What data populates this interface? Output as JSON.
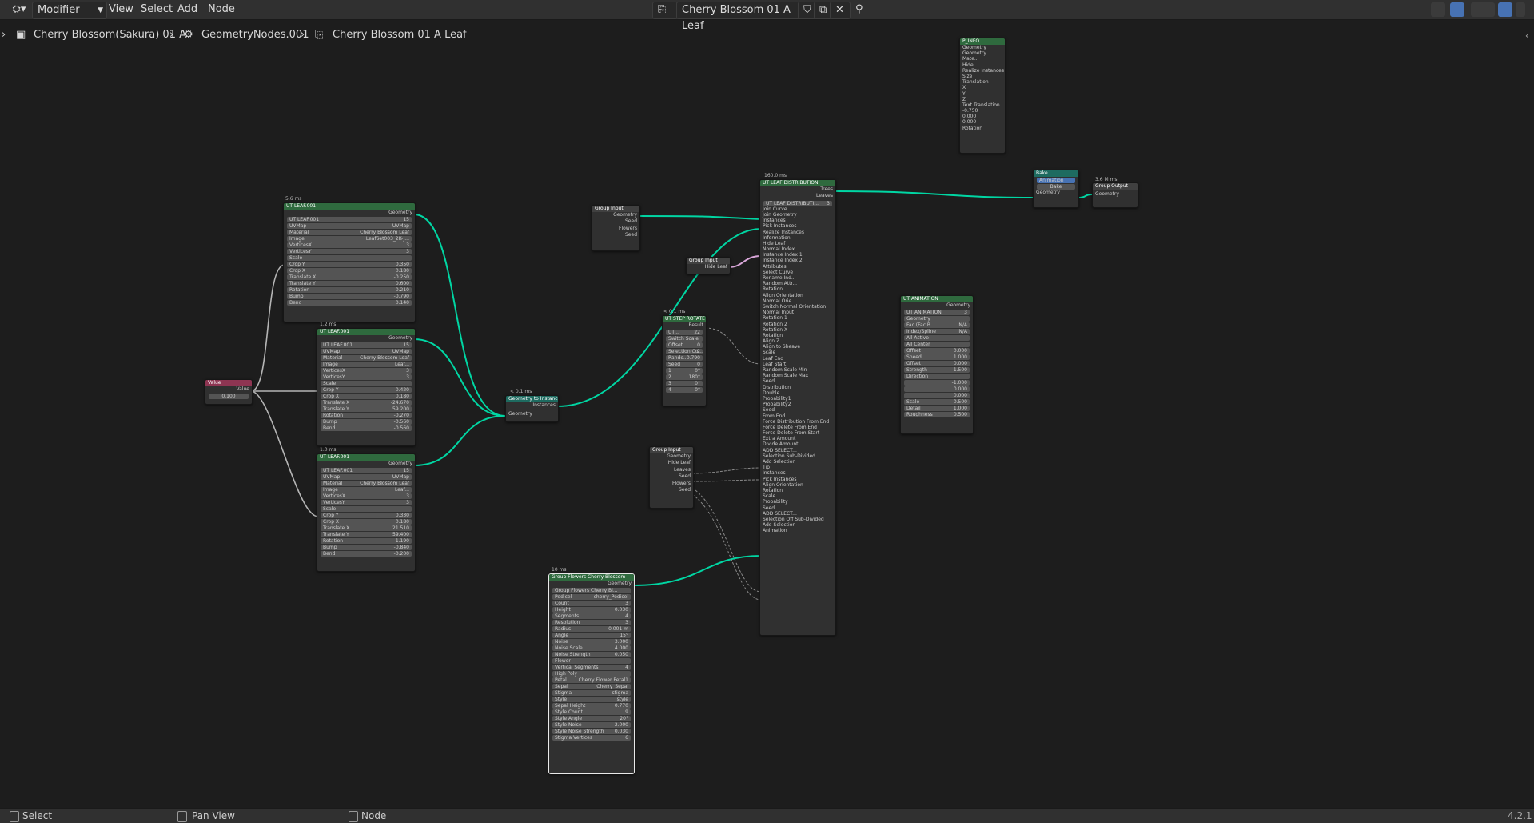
{
  "topbar": {
    "editor_type": "Modifier",
    "menus": [
      "View",
      "Select",
      "Add",
      "Node"
    ],
    "tree_name": "Cherry Blossom 01 A Leaf"
  },
  "breadcrumb": [
    "Cherry Blossom(Sakura) 01 A",
    "GeometryNodes.001",
    "Cherry Blossom 01 A Leaf"
  ],
  "status": {
    "select": "Select",
    "pan": "Pan View",
    "node": "Node",
    "version": "4.2.1"
  },
  "nodes": {
    "leaf1": {
      "timing": "5.6 ms",
      "title": "UT LEAF.001",
      "group": "UT LEAF.001",
      "users": "15",
      "rows": [
        {
          "l": "UVMap",
          "v": "UVMap"
        },
        {
          "l": "Material",
          "v": "Cherry Blossom Leaf"
        },
        {
          "l": "Image",
          "v": "LeafSet003_2K-J..."
        },
        {
          "l": "VerticesX",
          "v": "3"
        },
        {
          "l": "VerticesY",
          "v": "3"
        },
        {
          "l": "Scale",
          "v": ""
        },
        {
          "l": "Crop Y",
          "v": "0.350"
        },
        {
          "l": "Crop X",
          "v": "0.180"
        },
        {
          "l": "Translate X",
          "v": "-0.250"
        },
        {
          "l": "Translate Y",
          "v": "0.600"
        },
        {
          "l": "Rotation",
          "v": "0.210"
        },
        {
          "l": "Bump",
          "v": "-0.790"
        },
        {
          "l": "Bend",
          "v": "0.140"
        }
      ]
    },
    "leaf2": {
      "timing": "1.2 ms",
      "title": "UT LEAF.001",
      "group": "UT LEAF.001",
      "users": "15",
      "rows": [
        {
          "l": "UVMap",
          "v": "UVMap"
        },
        {
          "l": "Material",
          "v": "Cherry Blossom Leaf"
        },
        {
          "l": "Image",
          "v": "Leaf..."
        },
        {
          "l": "VerticesX",
          "v": "3"
        },
        {
          "l": "VerticesY",
          "v": "3"
        },
        {
          "l": "Scale",
          "v": ""
        },
        {
          "l": "Crop Y",
          "v": "0.420"
        },
        {
          "l": "Crop X",
          "v": "0.180"
        },
        {
          "l": "Translate X",
          "v": "-24.670"
        },
        {
          "l": "Translate Y",
          "v": "59.200"
        },
        {
          "l": "Rotation",
          "v": "-0.270"
        },
        {
          "l": "Bump",
          "v": "-0.560"
        },
        {
          "l": "Bend",
          "v": "-0.560"
        }
      ]
    },
    "leaf3": {
      "timing": "1.0 ms",
      "title": "UT LEAF.001",
      "group": "UT LEAF.001",
      "users": "15",
      "rows": [
        {
          "l": "UVMap",
          "v": "UVMap"
        },
        {
          "l": "Material",
          "v": "Cherry Blossom Leaf"
        },
        {
          "l": "Image",
          "v": "Leaf..."
        },
        {
          "l": "VerticesX",
          "v": "3"
        },
        {
          "l": "VerticesY",
          "v": "3"
        },
        {
          "l": "Scale",
          "v": ""
        },
        {
          "l": "Crop Y",
          "v": "0.330"
        },
        {
          "l": "Crop X",
          "v": "0.180"
        },
        {
          "l": "Translate X",
          "v": "21.510"
        },
        {
          "l": "Translate Y",
          "v": "59.400"
        },
        {
          "l": "Rotation",
          "v": "-1.190"
        },
        {
          "l": "Bump",
          "v": "-0.840"
        },
        {
          "l": "Bend",
          "v": "-0.200"
        }
      ]
    },
    "value": {
      "title": "Value",
      "label": "Value",
      "value": "0.100"
    },
    "g2i": {
      "timing": "< 0.1 ms",
      "title": "Geometry to Instance",
      "out": "Instances",
      "in": "Geometry"
    },
    "gi1": {
      "title": "Group Input",
      "rows": [
        "Geometry",
        "Seed",
        "Flowers",
        "Seed"
      ]
    },
    "hide": {
      "title": "Group Input",
      "row": "Hide Leaf"
    },
    "step": {
      "timing": "< 0.1 ms",
      "title": "UT STEP ROTATE",
      "group": "UT...",
      "users": "22",
      "rows": [
        {
          "l": "Switch Scale",
          "v": ""
        },
        {
          "l": "Offset",
          "v": "0"
        },
        {
          "l": "Selection Co...",
          "v": "2"
        },
        {
          "l": "Rando...",
          "v": "0.790"
        },
        {
          "l": "Seed",
          "v": "0"
        },
        {
          "l": "1",
          "v": "0°"
        },
        {
          "l": "2",
          "v": "180°"
        },
        {
          "l": "3",
          "v": "0°"
        },
        {
          "l": "4",
          "v": "0°"
        }
      ]
    },
    "dist": {
      "timing": "160.0 ms",
      "title": "UT LEAF DISTRIBUTION",
      "group": "UT LEAF DISTRIBUTI...",
      "users": "3",
      "rows": [
        "Join Curve",
        "Join Geometry",
        "Instances",
        "Pick Instances",
        "Realize Instances",
        "Information",
        "Hide Leaf",
        "Normal Index",
        "Instance Index 1",
        "Instance Index 2",
        "Attributes",
        "Select Curve",
        "Rename Ind...",
        "Random Attr...",
        "Rotation",
        "Align Orientation",
        "Normal Orie...",
        "Switch Normal Orientation",
        "Normal Input",
        "Rotation 1",
        "Rotation 2",
        "Rotation X",
        "Rotation",
        "Align Z",
        "Align to Sheave",
        "Scale",
        "Leaf End",
        "Leaf Start",
        "Random Scale Min",
        "Random Scale Max",
        "Seed",
        "Distribution",
        "Double",
        "Probability1",
        "Probability2",
        "Seed",
        "From End",
        "Force Distribution From End",
        "Force Delete From End",
        "Force Delete From Start",
        "Extra Amount",
        "Divide Amount",
        "ADD SELECT...",
        "Selection Sub-Divided",
        "Add Selection",
        "Tip",
        "Instances",
        "Pick Instances",
        "Align Orientation",
        "Rotation",
        "Scale",
        "Probability",
        "Seed",
        "ADD SELECT...",
        "Selection Off Sub-Divided",
        "Add Selection",
        "Animation"
      ]
    },
    "gi2": {
      "title": "Group Input",
      "rows": [
        "Geometry",
        "Hide Leaf",
        "Leaves",
        "Seed",
        "Flowers",
        "Seed"
      ]
    },
    "flowers": {
      "timing": "10 ms",
      "title": "Group Flowers Cherry Blossom",
      "group": "Group Flowers Cherry Bl...",
      "rows": [
        {
          "l": "Pedicel",
          "v": "cherry_Pedicel"
        },
        {
          "l": "Count",
          "v": "3"
        },
        {
          "l": "Height",
          "v": "0.030"
        },
        {
          "l": "Segments",
          "v": "4"
        },
        {
          "l": "Resolution",
          "v": "3"
        },
        {
          "l": "Radius",
          "v": "0.001 m"
        },
        {
          "l": "Angle",
          "v": "15°"
        },
        {
          "l": "Noise",
          "v": "3.000"
        },
        {
          "l": "Noise Scale",
          "v": "4.000"
        },
        {
          "l": "Noise Strength",
          "v": "0.050"
        },
        {
          "l": "Flower",
          "v": ""
        },
        {
          "l": "Vertical Segments",
          "v": "4"
        },
        {
          "l": "High Poly",
          "v": ""
        },
        {
          "l": "Petal",
          "v": "Cherry Flower Petal1"
        },
        {
          "l": "Sepal",
          "v": "Cherry_Sepal"
        },
        {
          "l": "Stigma",
          "v": "stigma"
        },
        {
          "l": "Style",
          "v": "style"
        },
        {
          "l": "Sepal Height",
          "v": "0.770"
        },
        {
          "l": "Style Count",
          "v": "9"
        },
        {
          "l": "Style Angle",
          "v": "20°"
        },
        {
          "l": "Style Noise",
          "v": "2.000"
        },
        {
          "l": "Style Noise Strength",
          "v": "0.030"
        },
        {
          "l": "Stigma Vertices",
          "v": "6"
        }
      ]
    },
    "pinfo": {
      "title": "P_INFO",
      "rows": [
        "Geometry",
        "Geometry",
        "Mate...",
        "Hide",
        "Realize Instances",
        "Size",
        "Translation",
        "X",
        "Y",
        "Z",
        "Text Translation",
        "-0.750",
        "0.000",
        "0.000",
        "Rotation"
      ]
    },
    "anim": {
      "title": "UT ANIMATION",
      "group": "UT ANIMATION",
      "users": "3",
      "rows": [
        {
          "l": "Geometry",
          "v": ""
        },
        {
          "l": "Fac (Fac B...",
          "v": "N/A"
        },
        {
          "l": "Index/Spline",
          "v": "N/A"
        },
        {
          "l": "All Active",
          "v": ""
        },
        {
          "l": "All Center",
          "v": ""
        },
        {
          "l": "Offset",
          "v": "0.000"
        },
        {
          "l": "Speed",
          "v": "1.000"
        },
        {
          "l": "Offset",
          "v": "0.000"
        },
        {
          "l": "Strength",
          "v": "1.500"
        },
        {
          "l": "Direction",
          "v": ""
        },
        {
          "l": "",
          "v": "-1.000"
        },
        {
          "l": "",
          "v": "0.000"
        },
        {
          "l": "",
          "v": "0.000"
        },
        {
          "l": "Scale",
          "v": "0.500"
        },
        {
          "l": "Detail",
          "v": "1.000"
        },
        {
          "l": "Roughness",
          "v": "0.500"
        }
      ]
    },
    "bake": {
      "title": "Bake",
      "row1": "Animation",
      "row2": "Bake",
      "row3": "Geometry"
    },
    "output": {
      "timing": "3.6 M ms",
      "title": "Group Output",
      "row": "Geometry"
    }
  },
  "colors": {
    "link": "#00d6a3",
    "link_gray": "#b5b5b5",
    "link_pink": "#d9a6d9",
    "accent": "#4772b3"
  }
}
